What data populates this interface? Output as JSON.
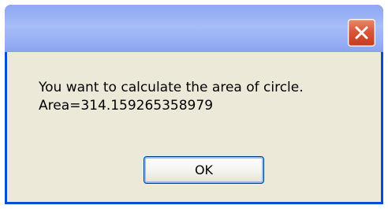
{
  "window": {
    "title": "",
    "close_icon": "close-icon"
  },
  "dialog": {
    "message_line1": "You want to calculate the area of circle.",
    "message_line2": "Area=314.159265358979",
    "ok_label": "OK"
  },
  "colors": {
    "frame": "#0a4bd6",
    "titlebar": "#a8bdf7",
    "close_button": "#d9573a",
    "client": "#ece9d8"
  }
}
